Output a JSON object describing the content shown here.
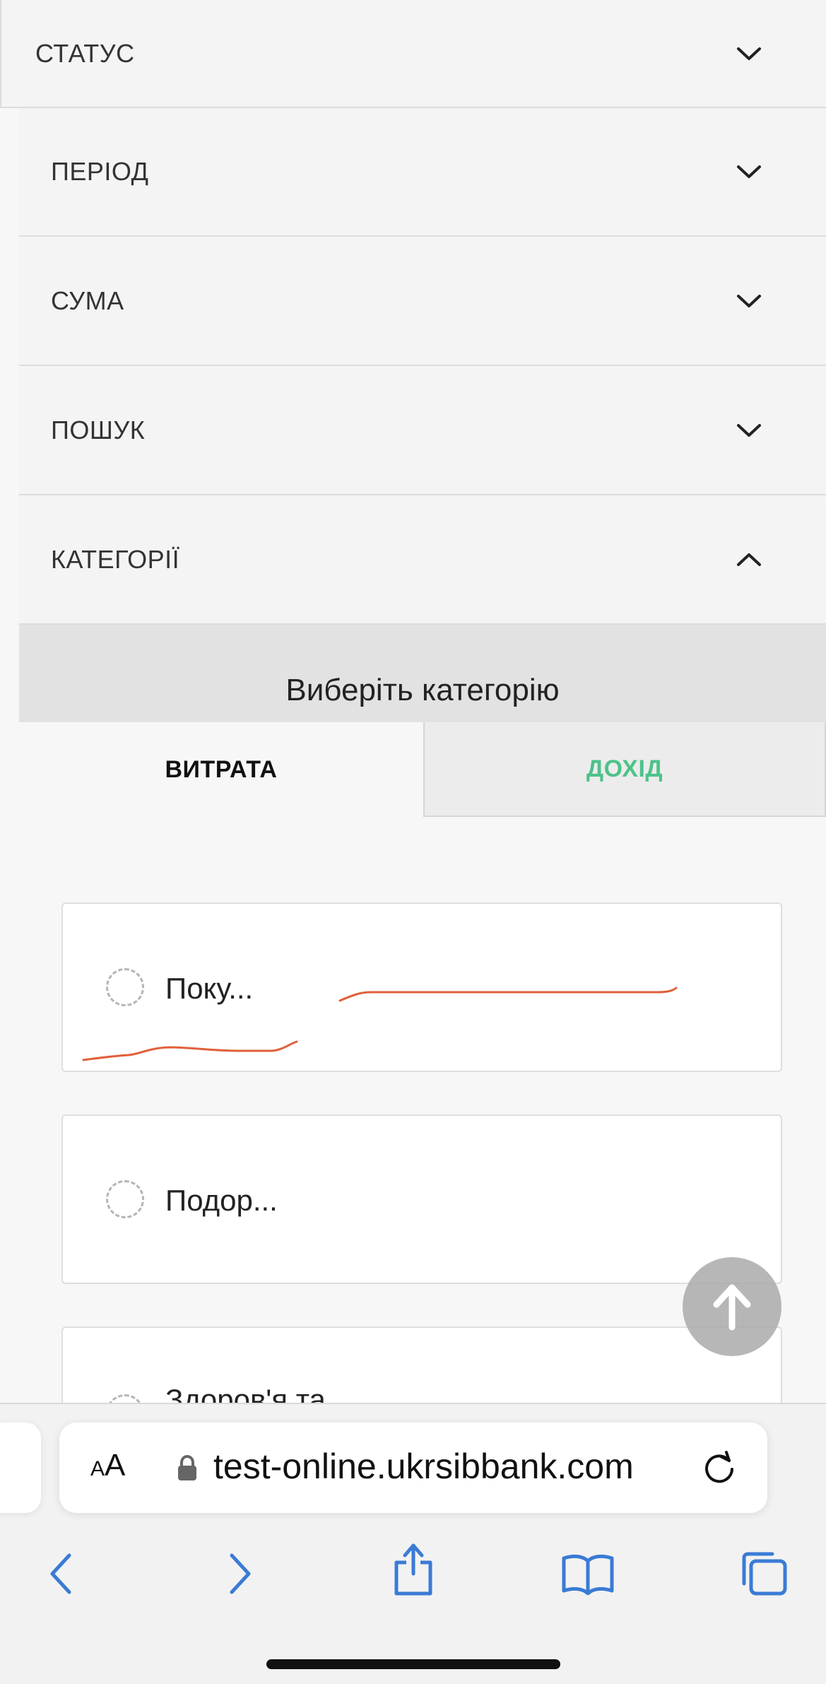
{
  "filters": {
    "status": "СТАТУС",
    "period": "ПЕРІОД",
    "amount": "СУМА",
    "search": "ПОШУК",
    "categories": "КАТЕГОРІЇ"
  },
  "category_picker": {
    "title": "Виберіть категорію",
    "tabs": {
      "expense": "ВИТРАТА",
      "income": "ДОХІД"
    },
    "items": [
      "Поку...",
      "Подор...",
      "Здоров'я та"
    ]
  },
  "browser": {
    "text_size": {
      "small": "A",
      "big": "A"
    },
    "url": "test-online.ukrsibbank.com"
  },
  "colors": {
    "income_tab": "#4cc38a",
    "annotation": "#e0603a"
  }
}
